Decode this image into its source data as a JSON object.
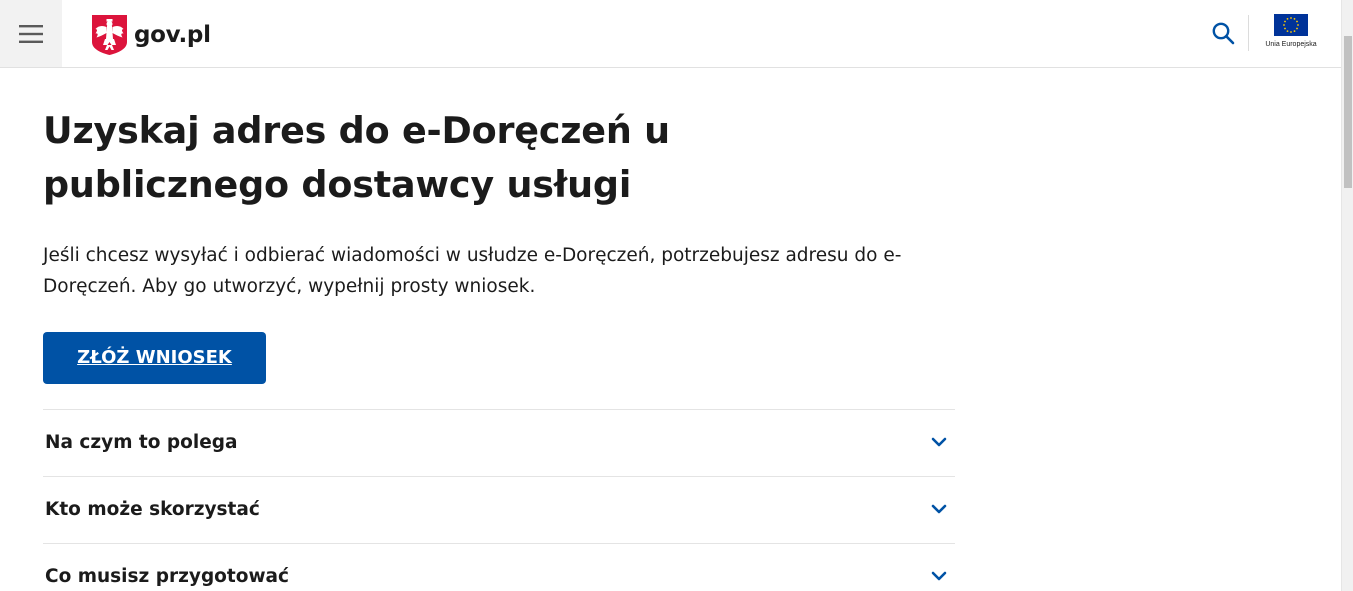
{
  "header": {
    "menu_icon": "hamburger-menu-icon",
    "logo_text": "gov.pl",
    "emblem_icon": "polish-eagle-emblem-icon",
    "search_icon": "search-icon",
    "eu_label": "Unia Europejska",
    "eu_flag_icon": "eu-flag-icon"
  },
  "main": {
    "title": "Uzyskaj adres do e-Doręczeń u publicznego dostawcy usługi",
    "lead": "Jeśli chcesz wysyłać i odbierać wiadomości w usłudze e-Doręczeń, potrzebujesz adresu do e-Doręczeń. Aby go utworzyć, wypełnij prosty wniosek.",
    "cta_label": "ZŁÓŻ WNIOSEK"
  },
  "accordion": {
    "items": [
      {
        "label": "Na czym to polega",
        "icon": "chevron-down-icon"
      },
      {
        "label": "Kto może skorzystać",
        "icon": "chevron-down-icon"
      },
      {
        "label": "Co musisz przygotować",
        "icon": "chevron-down-icon"
      }
    ]
  },
  "colors": {
    "accent": "#0052a5",
    "text": "#1b1b1b",
    "menu_bg": "#f2f2f2",
    "eu_blue": "#003399",
    "eu_gold": "#ffcc00",
    "emblem_red": "#dc143c"
  }
}
